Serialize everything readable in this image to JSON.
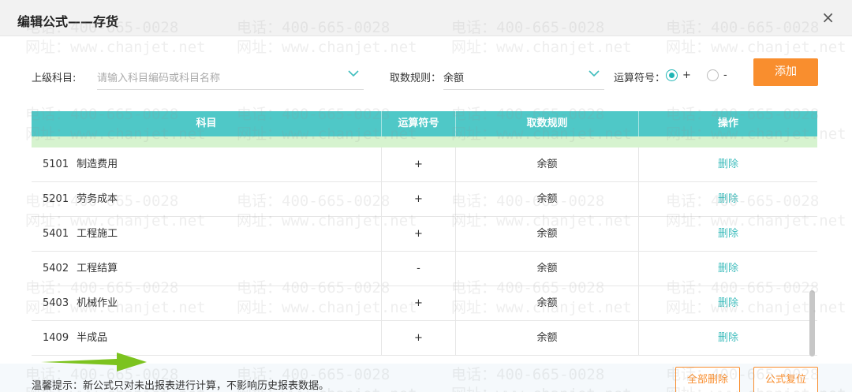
{
  "dialog": {
    "title": "编辑公式——存货",
    "close_icon": "×"
  },
  "watermark": {
    "phone": "电话：400-665-0028",
    "site": "网址：www.chanjet.net"
  },
  "filters": {
    "parent_label": "上级科目:",
    "parent_placeholder": "请输入科目编码或科目名称",
    "rule_label": "取数规则：",
    "rule_value": "余额",
    "operator_label": "运算符号：",
    "plus_label": "+",
    "minus_label": "-",
    "operator_selected": "+",
    "add_button": "添加"
  },
  "table": {
    "headers": [
      "科目",
      "运算符号",
      "取数规则",
      "操作"
    ],
    "rows": [
      {
        "code": "5101",
        "name": "制造费用",
        "op": "+",
        "rule": "余额",
        "action": "删除"
      },
      {
        "code": "5201",
        "name": "劳务成本",
        "op": "+",
        "rule": "余额",
        "action": "删除"
      },
      {
        "code": "5401",
        "name": "工程施工",
        "op": "+",
        "rule": "余额",
        "action": "删除"
      },
      {
        "code": "5402",
        "name": "工程结算",
        "op": "-",
        "rule": "余额",
        "action": "删除"
      },
      {
        "code": "5403",
        "name": "机械作业",
        "op": "+",
        "rule": "余额",
        "action": "删除"
      },
      {
        "code": "1409",
        "name": "半成品",
        "op": "+",
        "rule": "余额",
        "action": "删除"
      }
    ]
  },
  "footer": {
    "tip": "温馨提示：新公式只对未出报表进行计算，不影响历史报表数据。",
    "delete_all": "全部删除",
    "reset": "公式复位"
  },
  "colors": {
    "accent": "#4fc8c7",
    "link": "#3fbdbd",
    "button": "#f98e2e",
    "arrow": "#7cc31f"
  }
}
